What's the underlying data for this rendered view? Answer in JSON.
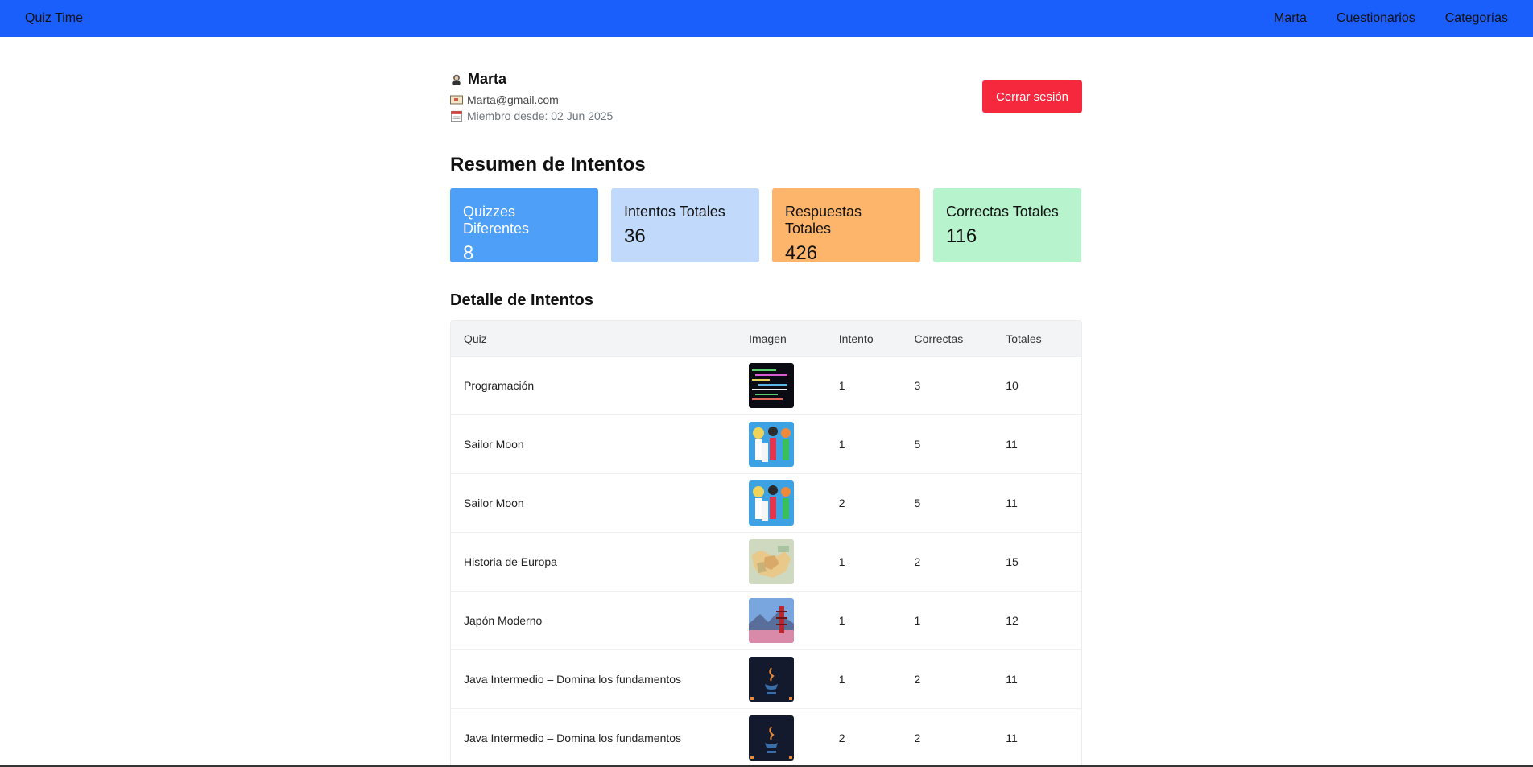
{
  "navbar": {
    "brand": "Quiz Time",
    "links": [
      "Marta",
      "Cuestionarios",
      "Categorías"
    ]
  },
  "profile": {
    "name": "Marta",
    "email": "Marta@gmail.com",
    "member_since": "Miembro desde: 02 Jun 2025",
    "logout_label": "Cerrar sesión"
  },
  "summary": {
    "title": "Resumen de Intentos",
    "cards": [
      {
        "label": "Quizzes Diferentes",
        "value": "8"
      },
      {
        "label": "Intentos Totales",
        "value": "36"
      },
      {
        "label": "Respuestas Totales",
        "value": "426"
      },
      {
        "label": "Correctas Totales",
        "value": "116"
      }
    ]
  },
  "detail": {
    "title": "Detalle de Intentos",
    "headers": [
      "Quiz",
      "Imagen",
      "Intento",
      "Correctas",
      "Totales"
    ],
    "rows": [
      {
        "quiz": "Programación",
        "image": "code-thumbnail",
        "intento": "1",
        "correctas": "3",
        "totales": "10"
      },
      {
        "quiz": "Sailor Moon",
        "image": "anime-thumbnail",
        "intento": "1",
        "correctas": "5",
        "totales": "11"
      },
      {
        "quiz": "Sailor Moon",
        "image": "anime-thumbnail",
        "intento": "2",
        "correctas": "5",
        "totales": "11"
      },
      {
        "quiz": "Historia de Europa",
        "image": "map-thumbnail",
        "intento": "1",
        "correctas": "2",
        "totales": "15"
      },
      {
        "quiz": "Japón Moderno",
        "image": "pagoda-thumbnail",
        "intento": "1",
        "correctas": "1",
        "totales": "12"
      },
      {
        "quiz": "Java Intermedio – Domina los fundamentos",
        "image": "java-thumbnail",
        "intento": "1",
        "correctas": "2",
        "totales": "11"
      },
      {
        "quiz": "Java Intermedio – Domina los fundamentos",
        "image": "java-thumbnail",
        "intento": "2",
        "correctas": "2",
        "totales": "11"
      }
    ]
  }
}
